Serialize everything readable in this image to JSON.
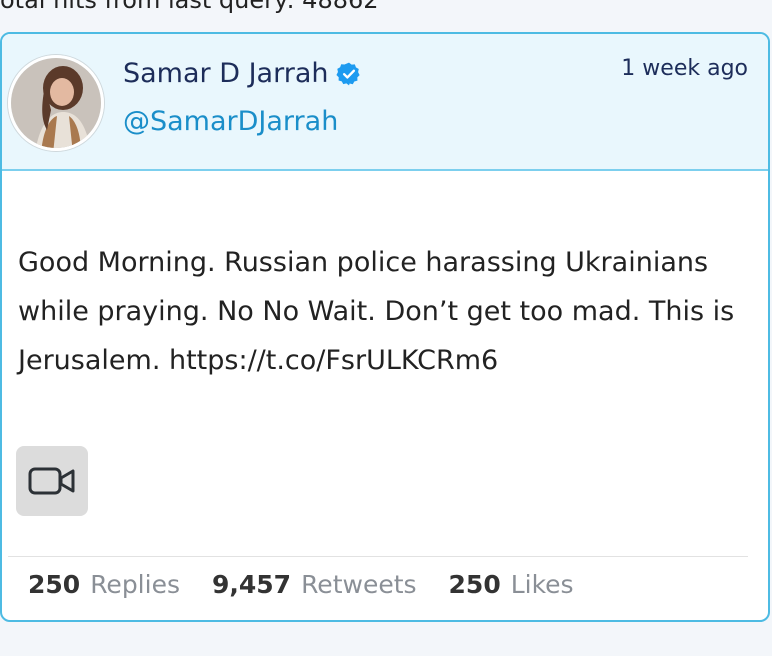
{
  "top_text": "otal hits from last query: 48862",
  "tweet": {
    "author_name": "Samar D Jarrah",
    "handle": "@SamarDJarrah",
    "time": "1 week ago",
    "text": "Good Morning. Russian police harassing Ukrainians while praying. No No Wait. Don’t get too mad. This is Jerusalem. https://t.co/FsrULKCRm6",
    "media_icon": "video-camera-icon",
    "verified_icon": "verified-badge-icon",
    "stats": {
      "replies_count": "250",
      "replies_label": "Replies",
      "retweets_count": "9,457",
      "retweets_label": "Retweets",
      "likes_count": "250",
      "likes_label": "Likes"
    }
  },
  "colors": {
    "card_border": "#4dbbe3",
    "header_bg": "#e9f7fd",
    "name": "#1d2d5a",
    "handle": "#1a8ec9",
    "verified": "#1d9bf0"
  }
}
